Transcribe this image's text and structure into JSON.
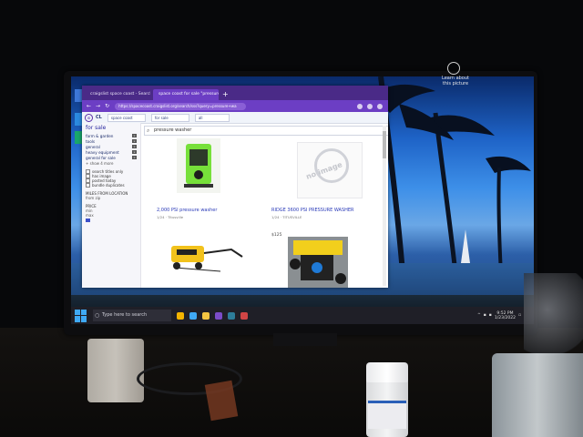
{
  "desktop": {
    "system_icon_label_1": "Learn about",
    "system_icon_label_2": "this picture"
  },
  "taskbar": {
    "search_placeholder": "Type here to search",
    "time": "9:52 PM",
    "date": "1/23/2022"
  },
  "browser": {
    "tabs": [
      {
        "label": "craigslist space coast - Search",
        "active": false
      },
      {
        "label": "space coast for sale \"pressure wa",
        "active": true
      }
    ],
    "new_tab": "+",
    "url": "https://spacecoast.craigslist.org/search/sss?query=pressure+wa",
    "nav": {
      "back": "←",
      "forward": "→",
      "reload": "↻"
    }
  },
  "cl_header": {
    "logo": "CL",
    "location": "space coast",
    "section": "for sale",
    "filter": "all"
  },
  "sidebar": {
    "title": "for sale",
    "categories": [
      "farm & garden",
      "tools",
      "general",
      "heavy equipment",
      "general for sale"
    ],
    "more": "+ show 4 more",
    "search_label": "search titles only",
    "checks": [
      "search titles only",
      "has image",
      "posted today",
      "bundle duplicates"
    ],
    "miles_label": "MILES FROM LOCATION",
    "zip_label": "from zip",
    "price_label": "PRICE",
    "min_label": "min",
    "max_label": "max"
  },
  "search": {
    "query": "pressure washer"
  },
  "listings": [
    {
      "title": "2,000 PSI pressure washer",
      "price": "",
      "meta": "1/24 · Titusville"
    },
    {
      "title": "RIDGE 3600 PSI PRESSURE WASHER",
      "price": "",
      "meta": "1/24 · TITUSVILLE"
    },
    {
      "title": "",
      "price": "",
      "meta": ""
    },
    {
      "title": "",
      "price": "$125",
      "meta": ""
    }
  ],
  "no_image_text": "no image"
}
